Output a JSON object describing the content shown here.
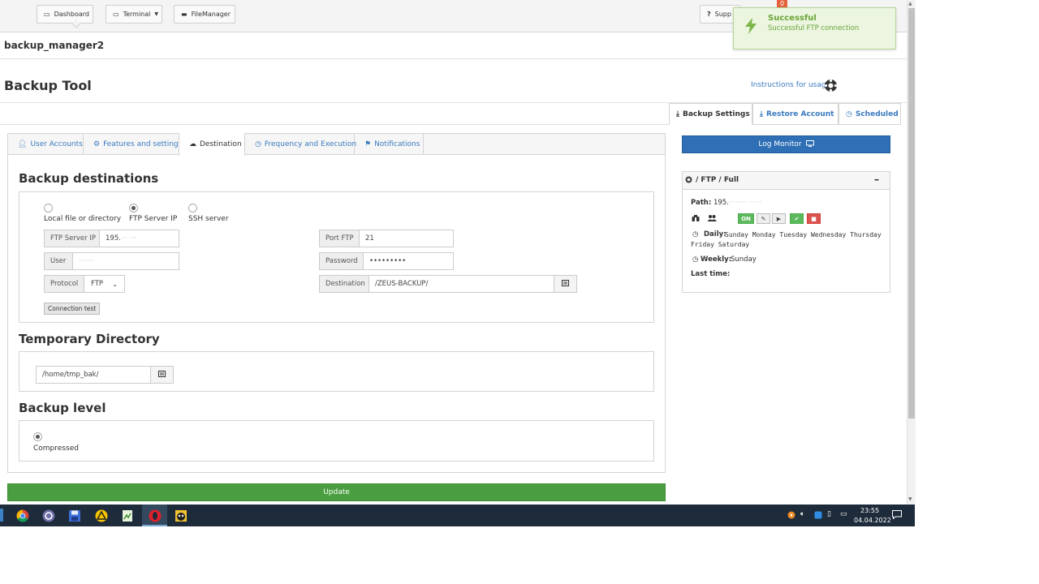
{
  "topnav": {
    "dashboard": "Dashboard",
    "terminal": "Terminal",
    "filemanager": "FileManager",
    "support": "Supp",
    "notification_count": "0"
  },
  "account": {
    "name": "backup_manager2"
  },
  "page": {
    "title": "Backup Tool",
    "instructions": "Instructions for usage"
  },
  "right_tabs": [
    "Backup Settings",
    "Restore Account",
    "Scheduled"
  ],
  "tabs": [
    "User Accounts",
    "Features and settings",
    "Destination",
    "Frequency and Execution",
    "Notifications"
  ],
  "destinations": {
    "title": "Backup destinations",
    "options": [
      "Local file or directory",
      "FTP Server IP",
      "SSH server"
    ],
    "selected": "FTP Server IP",
    "ftp_ip_label": "FTP Server IP",
    "ftp_ip_value": "195.",
    "ftp_ip_hidden": "··· ···",
    "port_label": "Port FTP",
    "port_value": "21",
    "user_label": "User",
    "user_value": "·······",
    "password_label": "Password",
    "password_value": "•••••••••",
    "protocol_label": "Protocol",
    "protocol_value": "FTP",
    "destination_label": "Destination",
    "destination_value": "/ZEUS-BACKUP/",
    "conn_test": "Connection test"
  },
  "temp_dir": {
    "title": "Temporary Directory",
    "value": "/home/tmp_bak/"
  },
  "level": {
    "title": "Backup level",
    "option": "Compressed"
  },
  "update_label": "Update",
  "log_monitor": "Log Monitor",
  "job": {
    "title": "/ FTP / Full",
    "path_label": "Path:",
    "path_value": "195.",
    "path_hidden": "········ ······",
    "on_label": "ON",
    "daily_label": "Daily:",
    "daily_days": "Sunday Monday Tuesday Wednesday Thursday Friday Saturday",
    "weekly_label": "Weekly:",
    "weekly_days": "Sunday",
    "last_time_label": "Last time:"
  },
  "toast": {
    "title": "Successful",
    "message": "Successful FTP connection"
  },
  "taskbar": {
    "time": "23:55",
    "date": "04.04.2022"
  }
}
